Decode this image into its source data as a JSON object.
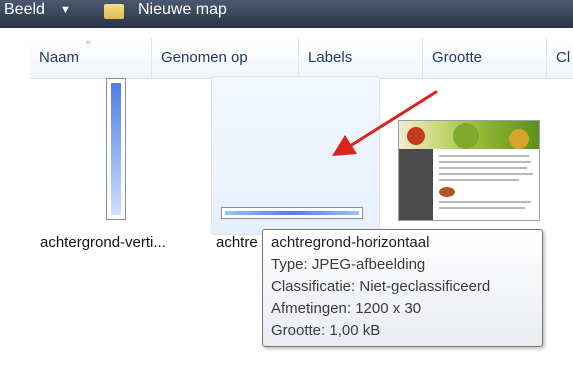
{
  "toolbar": {
    "view_label": "Beeld",
    "dropdown_arrow": "▼",
    "new_folder_label": "Nieuwe map",
    "folder_icon": "folder-icon"
  },
  "columns": [
    "Naam",
    "Genomen op",
    "Labels",
    "Grootte",
    "Cl"
  ],
  "sort_indicator": "^",
  "files": [
    {
      "name": "achtergrond-verti...",
      "thumbnail": "vertical-gradient"
    },
    {
      "name": "achtre",
      "thumbnail": "horizontal-gradient"
    },
    {
      "name": "",
      "thumbnail": "webpage-fruit"
    }
  ],
  "tooltip": {
    "title": "achtregrond-horizontaal",
    "type": "Type: JPEG-afbeelding",
    "classification": "Classificatie: Niet-geclassificeerd",
    "dimensions": "Afmetingen: 1200 x 30",
    "size": "Grootte: 1,00 kB"
  },
  "colors": {
    "toolbar_bg": "#2f3d4f",
    "header_text": "#1e395b",
    "annotation_arrow": "#d9241c",
    "hover_bg": "#e6f0fb"
  }
}
